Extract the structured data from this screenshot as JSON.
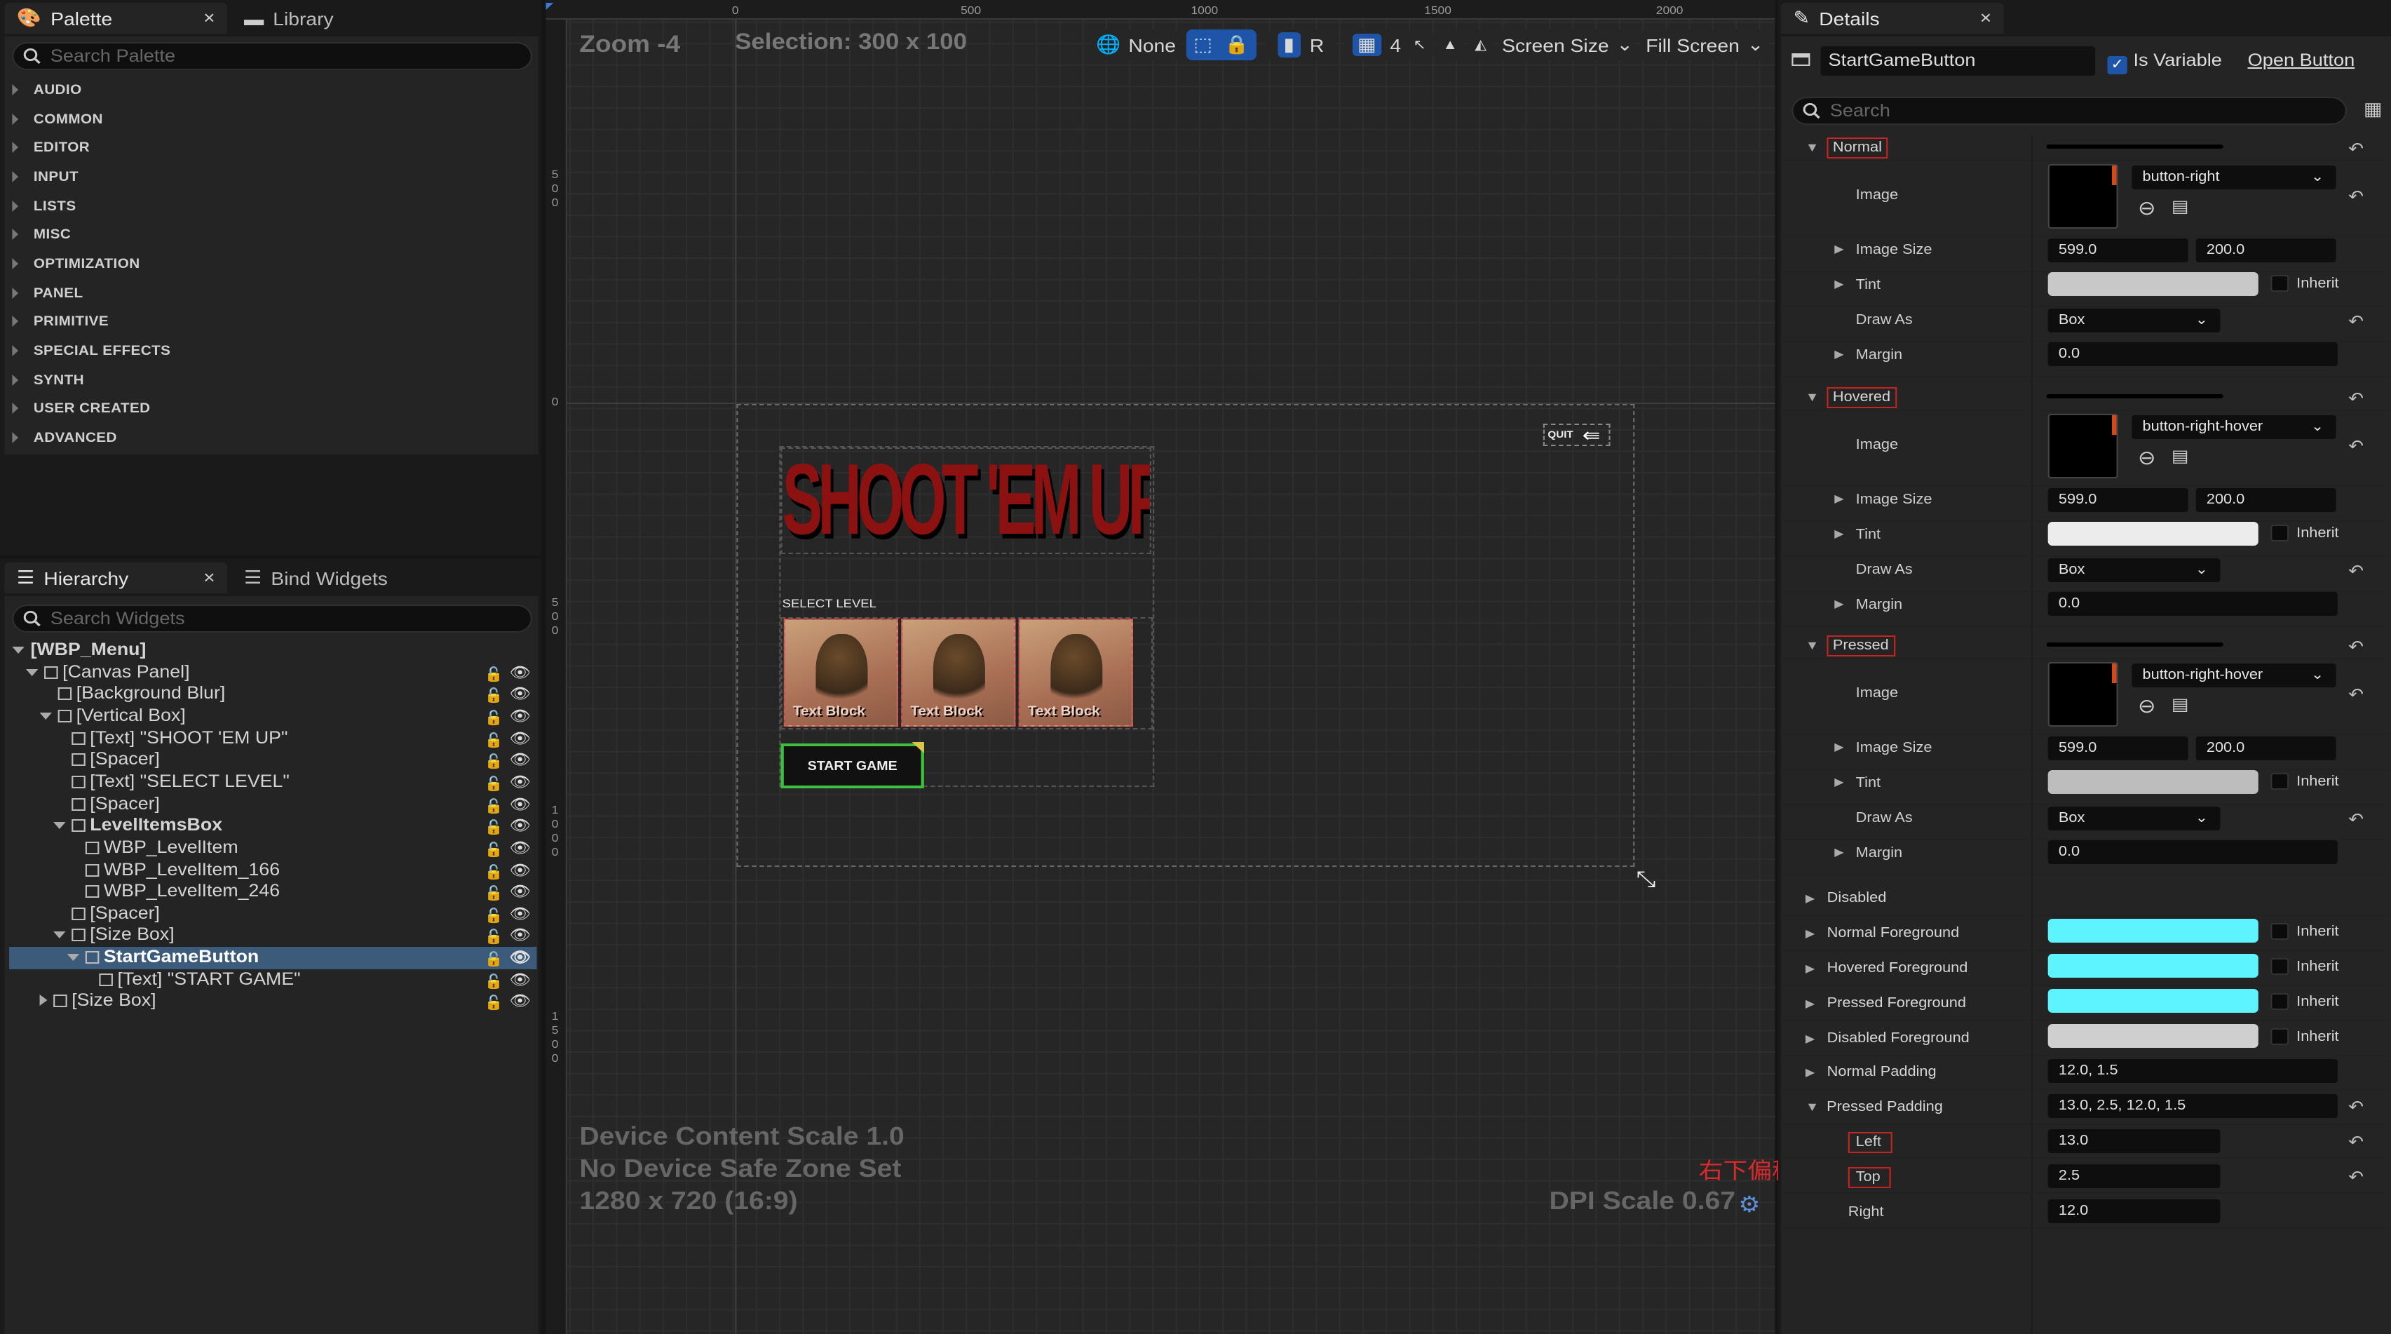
{
  "palette": {
    "tab": "Palette",
    "library_tab": "Library",
    "search_placeholder": "Search Palette",
    "categories": [
      "AUDIO",
      "COMMON",
      "EDITOR",
      "INPUT",
      "LISTS",
      "MISC",
      "OPTIMIZATION",
      "PANEL",
      "PRIMITIVE",
      "SPECIAL EFFECTS",
      "SYNTH",
      "USER CREATED",
      "ADVANCED"
    ]
  },
  "hierarchy": {
    "tab": "Hierarchy",
    "bind_tab": "Bind Widgets",
    "search_placeholder": "Search Widgets",
    "rows": [
      "[WBP_Menu]",
      "[Canvas Panel]",
      "[Background Blur]",
      "[Vertical Box]",
      "[Text] \"SHOOT 'EM UP\"",
      "[Spacer]",
      "[Text] \"SELECT LEVEL\"",
      "[Spacer]",
      "LevelItemsBox",
      "WBP_LevelItem",
      "WBP_LevelItem_166",
      "WBP_LevelItem_246",
      "[Spacer]",
      "[Size Box]",
      "StartGameButton",
      "[Text] \"START GAME\"",
      "[Size Box]"
    ]
  },
  "viewport": {
    "zoom": "Zoom -4",
    "selection": "Selection: 300 x 100",
    "ruler_top": [
      "0",
      "500",
      "1000",
      "1500",
      "2000"
    ],
    "ruler_left": [
      "500",
      "0",
      "500",
      "1000",
      "1500"
    ],
    "toolbar": {
      "none": "None",
      "r": "R",
      "grid": "4",
      "screen_size": "Screen Size",
      "fill_screen": "Fill Screen"
    },
    "footer": {
      "scale": "Device Content Scale 1.0",
      "safe": "No Device Safe Zone Set",
      "res": "1280 x 720 (16:9)",
      "dpi": "DPI Scale 0.67"
    },
    "annotation": "右下偏移",
    "canvas": {
      "title": "SHOOT 'EM UP",
      "select_level": "SELECT LEVEL",
      "text_block": "Text Block",
      "start": "START GAME",
      "quit": "QUIT"
    }
  },
  "details": {
    "tab": "Details",
    "name": "StartGameButton",
    "is_variable": "Is Variable",
    "open": "Open Button",
    "search_placeholder": "Search",
    "labels": {
      "normal": "Normal",
      "hovered": "Hovered",
      "pressed": "Pressed",
      "image": "Image",
      "image_size": "Image Size",
      "tint": "Tint",
      "draw_as": "Draw As",
      "margin": "Margin",
      "inherit": "Inherit",
      "disabled": "Disabled",
      "normal_fg": "Normal Foreground",
      "hovered_fg": "Hovered Foreground",
      "pressed_fg": "Pressed Foreground",
      "disabled_fg": "Disabled Foreground",
      "normal_padding": "Normal Padding",
      "pressed_padding": "Pressed Padding",
      "left": "Left",
      "top": "Top",
      "right": "Right"
    },
    "normal": {
      "image": "button-right",
      "w": "599.0",
      "h": "200.0",
      "draw_as": "Box",
      "margin": "0.0"
    },
    "hovered": {
      "image": "button-right-hover",
      "w": "599.0",
      "h": "200.0",
      "draw_as": "Box",
      "margin": "0.0"
    },
    "pressed": {
      "image": "button-right-hover",
      "w": "599.0",
      "h": "200.0",
      "draw_as": "Box",
      "margin": "0.0"
    },
    "normal_padding": "12.0, 1.5",
    "pressed_padding": "13.0, 2.5, 12.0, 1.5",
    "left": "13.0",
    "top": "2.5",
    "right": "12.0",
    "colors": {
      "tint_normal": "#c8c8c8",
      "tint_hover": "#ececec",
      "tint_pressed": "#bdbdbd",
      "fg": "#5ef4ff",
      "disabled_fg": "#cfcfcf"
    }
  }
}
